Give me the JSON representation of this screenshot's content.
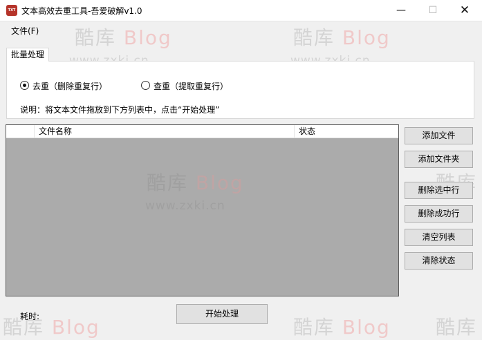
{
  "window": {
    "title": "文本高效去重工具-吾爱破解v1.0",
    "icon_text": "TXT",
    "minimize_glyph": "—",
    "maximize_glyph": "☐",
    "close_glyph": "✕"
  },
  "menu": {
    "file_label": "文件(F)"
  },
  "watermark": {
    "title_cn": "酷库",
    "title_blog": "Blog",
    "url": "www.zxki.cn"
  },
  "tab": {
    "label": "批量处理",
    "mode_dedupe_label": "去重（删除重复行）",
    "mode_dedupe_selected": true,
    "mode_extract_label": "查重（提取重复行）",
    "mode_extract_selected": false,
    "hint": "说明：将文本文件拖放到下方列表中，点击“开始处理”"
  },
  "file_list": {
    "columns": [
      "",
      "文件名称",
      "状态"
    ],
    "rows": []
  },
  "buttons": {
    "add_file": "添加文件",
    "add_folder": "添加文件夹",
    "delete_selected": "删除选中行",
    "delete_success": "删除成功行",
    "clear_list": "清空列表",
    "clear_status": "清除状态",
    "start": "开始处理"
  },
  "status": {
    "elapsed_label": "耗时:"
  },
  "colors": {
    "list_background": "#ababab",
    "icon_red": "#b5342a",
    "watermark_blog": "#f0c9c9"
  }
}
